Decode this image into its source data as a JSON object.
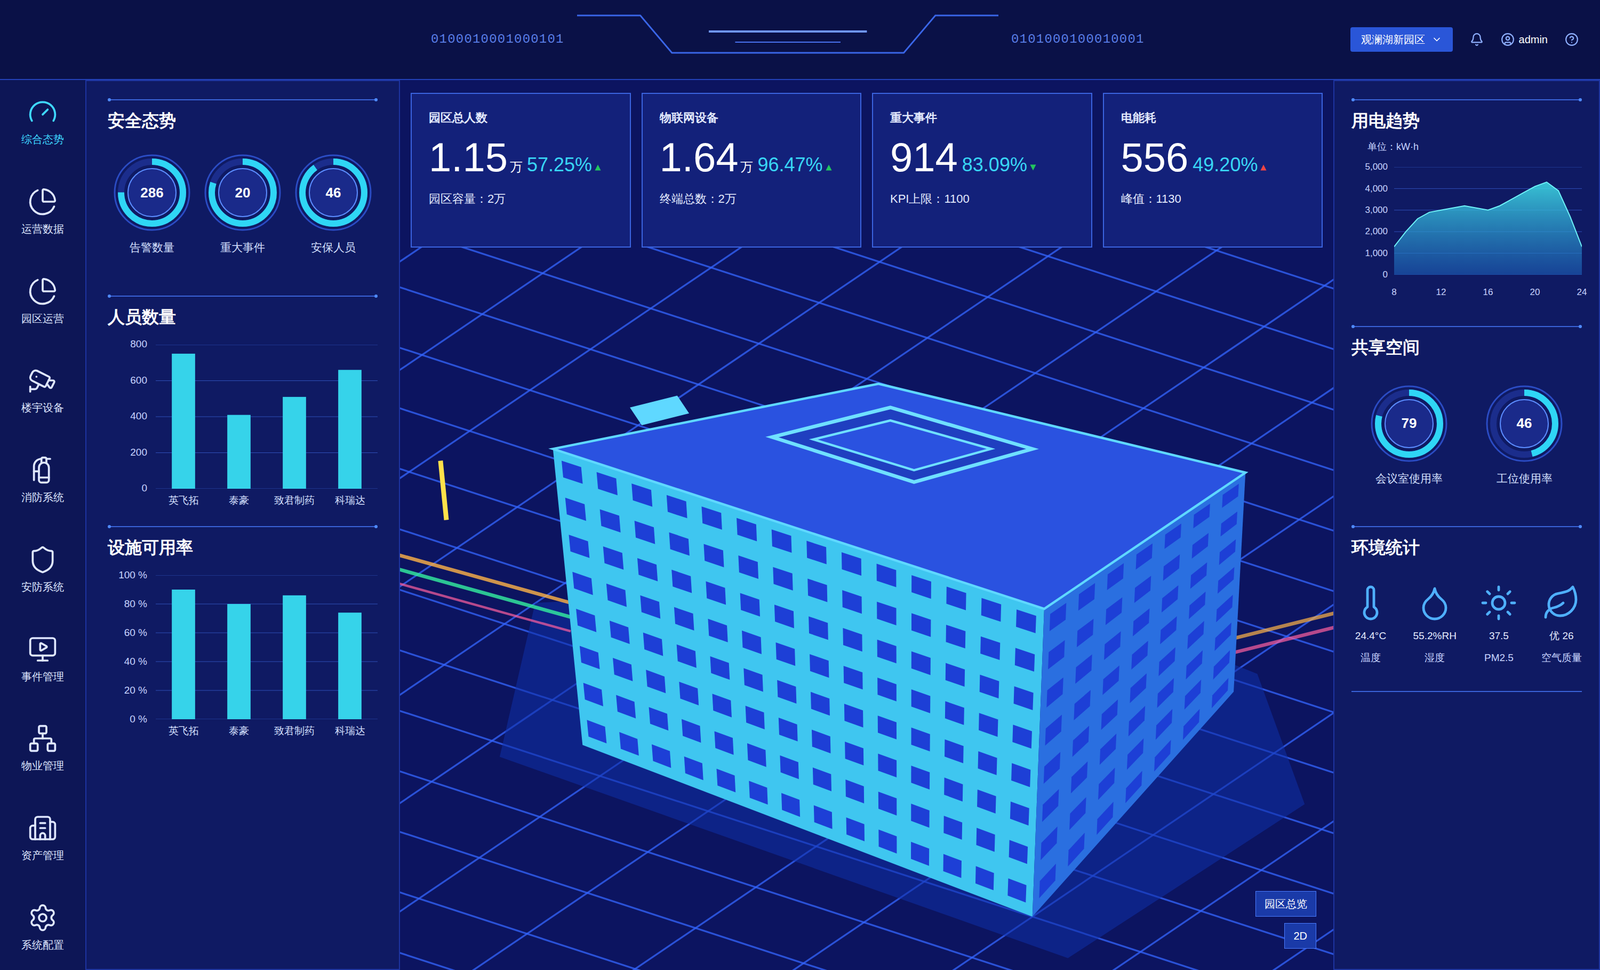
{
  "header": {
    "binary_left": "0100010001000101",
    "binary_right": "0101000100010001",
    "park_select": "观澜湖新园区",
    "user": "admin"
  },
  "sidebar": {
    "items": [
      {
        "label": "综合态势",
        "selected": true
      },
      {
        "label": "运营数据",
        "selected": false
      },
      {
        "label": "园区运营",
        "selected": false
      },
      {
        "label": "楼宇设备",
        "selected": false
      },
      {
        "label": "消防系统",
        "selected": false
      },
      {
        "label": "安防系统",
        "selected": false
      },
      {
        "label": "事件管理",
        "selected": false
      },
      {
        "label": "物业管理",
        "selected": false
      },
      {
        "label": "资产管理",
        "selected": false
      },
      {
        "label": "系统配置",
        "selected": false
      }
    ]
  },
  "safety": {
    "title": "安全态势",
    "gauges": [
      {
        "value": "286",
        "label": "告警数量",
        "level": 0.75
      },
      {
        "value": "20",
        "label": "重大事件",
        "level": 0.8
      },
      {
        "value": "46",
        "label": "安保人员",
        "level": 0.9
      }
    ]
  },
  "people_chart": {
    "title": "人员数量",
    "y_ticks": [
      "800",
      "600",
      "400",
      "200",
      "0"
    ],
    "y_max": 800,
    "categories": [
      "英飞拓",
      "泰豪",
      "致君制药",
      "科瑞达"
    ],
    "values": [
      750,
      410,
      510,
      660
    ]
  },
  "facility_chart": {
    "title": "设施可用率",
    "y_ticks": [
      "100 %",
      "80 %",
      "60 %",
      "40 %",
      "20 %",
      "0 %"
    ],
    "y_max": 100,
    "categories": [
      "英飞拓",
      "泰豪",
      "致君制药",
      "科瑞达"
    ],
    "values": [
      90,
      80,
      86,
      74
    ]
  },
  "kpi_cards": [
    {
      "title": "园区总人数",
      "value": "1.15",
      "unit": "万",
      "percent": "57.25%",
      "trend": "up",
      "trend_color": "#22c55e",
      "note": "园区容量：2万"
    },
    {
      "title": "物联网设备",
      "value": "1.64",
      "unit": "万",
      "percent": "96.47%",
      "trend": "up",
      "trend_color": "#22c55e",
      "note": "终端总数：2万"
    },
    {
      "title": "重大事件",
      "value": "914",
      "unit": "",
      "percent": "83.09%",
      "trend": "down",
      "trend_color": "#22c55e",
      "note": "KPI上限：1100"
    },
    {
      "title": "电能耗",
      "value": "556",
      "unit": "",
      "percent": "49.20%",
      "trend": "up",
      "trend_color": "#ef4444",
      "note": "峰值：1130"
    }
  ],
  "scene": {
    "buttons": [
      {
        "label": "园区总览"
      },
      {
        "label": "2D"
      }
    ]
  },
  "power_chart": {
    "title": "用电趋势",
    "unit": "单位：kW·h",
    "y_ticks": [
      "5,000",
      "4,000",
      "3,000",
      "2,000",
      "1,000",
      "0"
    ],
    "y_max": 5000,
    "x_ticks": [
      "8",
      "12",
      "16",
      "20",
      "24"
    ],
    "values": [
      1300,
      2000,
      2600,
      2900,
      3000,
      3100,
      3200,
      3100,
      3000,
      3200,
      3500,
      3800,
      4100,
      4300,
      3900,
      2700,
      1300
    ]
  },
  "shared_space": {
    "title": "共享空间",
    "gauges": [
      {
        "value": "79",
        "label": "会议室使用率",
        "level": 0.79
      },
      {
        "value": "46",
        "label": "工位使用率",
        "level": 0.46
      }
    ]
  },
  "environment": {
    "title": "环境统计",
    "items": [
      {
        "value": "24.4°C",
        "label": "温度"
      },
      {
        "value": "55.2%RH",
        "label": "湿度"
      },
      {
        "value": "37.5",
        "label": "PM2.5"
      },
      {
        "value": "优 26",
        "label": "空气质量"
      }
    ]
  }
}
